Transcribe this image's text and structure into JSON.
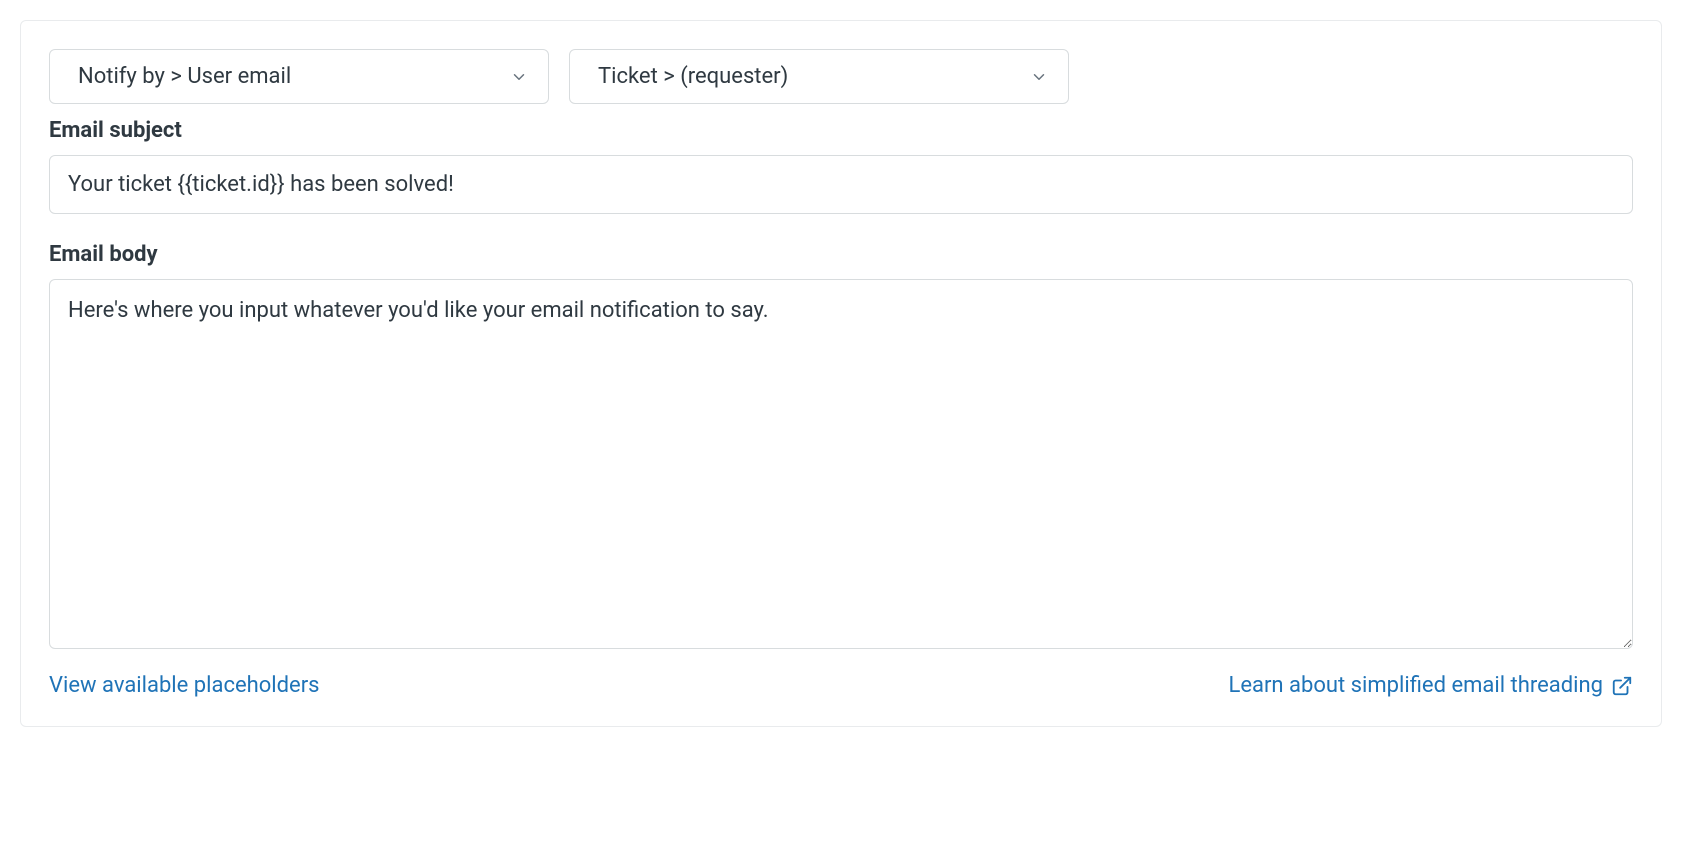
{
  "action": {
    "notify_by": "Notify by > User email",
    "recipient": "Ticket > (requester)"
  },
  "email_subject": {
    "label": "Email subject",
    "value": "Your ticket {{ticket.id}} has been solved!"
  },
  "email_body": {
    "label": "Email body",
    "value": "Here's where you input whatever you'd like your email notification to say."
  },
  "links": {
    "placeholders": "View available placeholders",
    "threading": "Learn about simplified email threading"
  }
}
